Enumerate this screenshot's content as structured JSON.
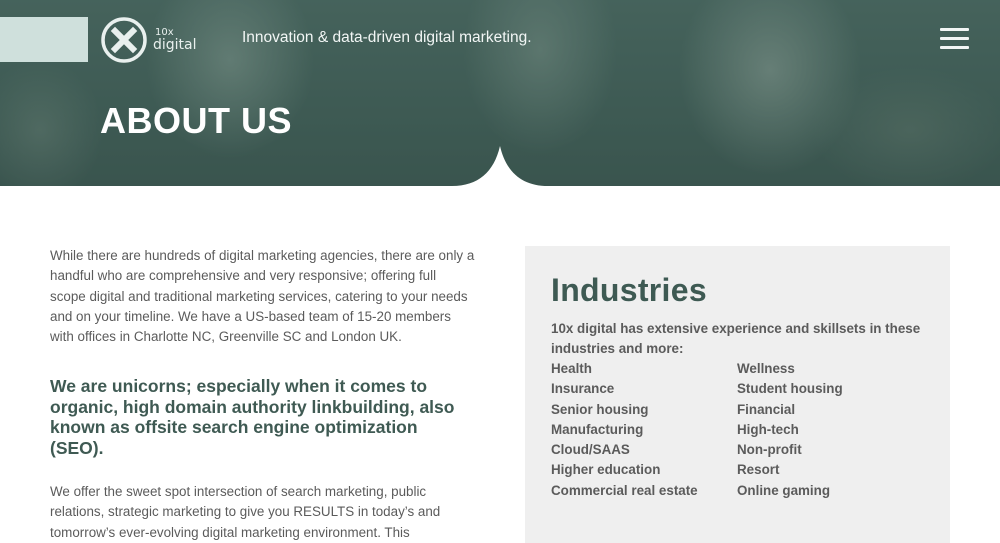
{
  "header": {
    "logo": {
      "small_text": "10x",
      "brand_text": "digital"
    },
    "tagline": "Innovation & data-driven digital marketing.",
    "menu_icon": "hamburger-menu-icon"
  },
  "hero": {
    "title": "ABOUT US"
  },
  "main": {
    "intro": "While there are hundreds of digital marketing agencies, there are only a handful who are comprehensive and very responsive; offering full scope digital and traditional marketing services, catering to your needs and on your timeline. We have a US-based team of 15-20 members with offices in Charlotte NC, Greenville SC and London UK.",
    "highlight": "We are unicorns; especially when it comes to organic, high domain authority linkbuilding, also known as offsite search engine optimization (SEO).",
    "offer": "We offer the sweet spot intersection of search marketing, public relations, strategic marketing to give you RESULTS in today’s and tomorrow’s ever-evolving digital marketing environment. This"
  },
  "industries": {
    "title": "Industries",
    "intro": "10x digital has extensive experience and skillsets in these industries and more:",
    "left": [
      "Health",
      "Insurance",
      "Senior housing",
      "Manufacturing",
      "Cloud/SAAS",
      "Higher education",
      "Commercial real estate"
    ],
    "right": [
      "Wellness",
      "Student housing",
      "Financial",
      "High-tech",
      "Non-profit",
      "Resort",
      "Online gaming"
    ]
  },
  "colors": {
    "brand_green": "#3e5a53",
    "panel_bg": "#efefef",
    "body_text": "#5b5b5b",
    "logo_block": "#cfe0dc"
  }
}
